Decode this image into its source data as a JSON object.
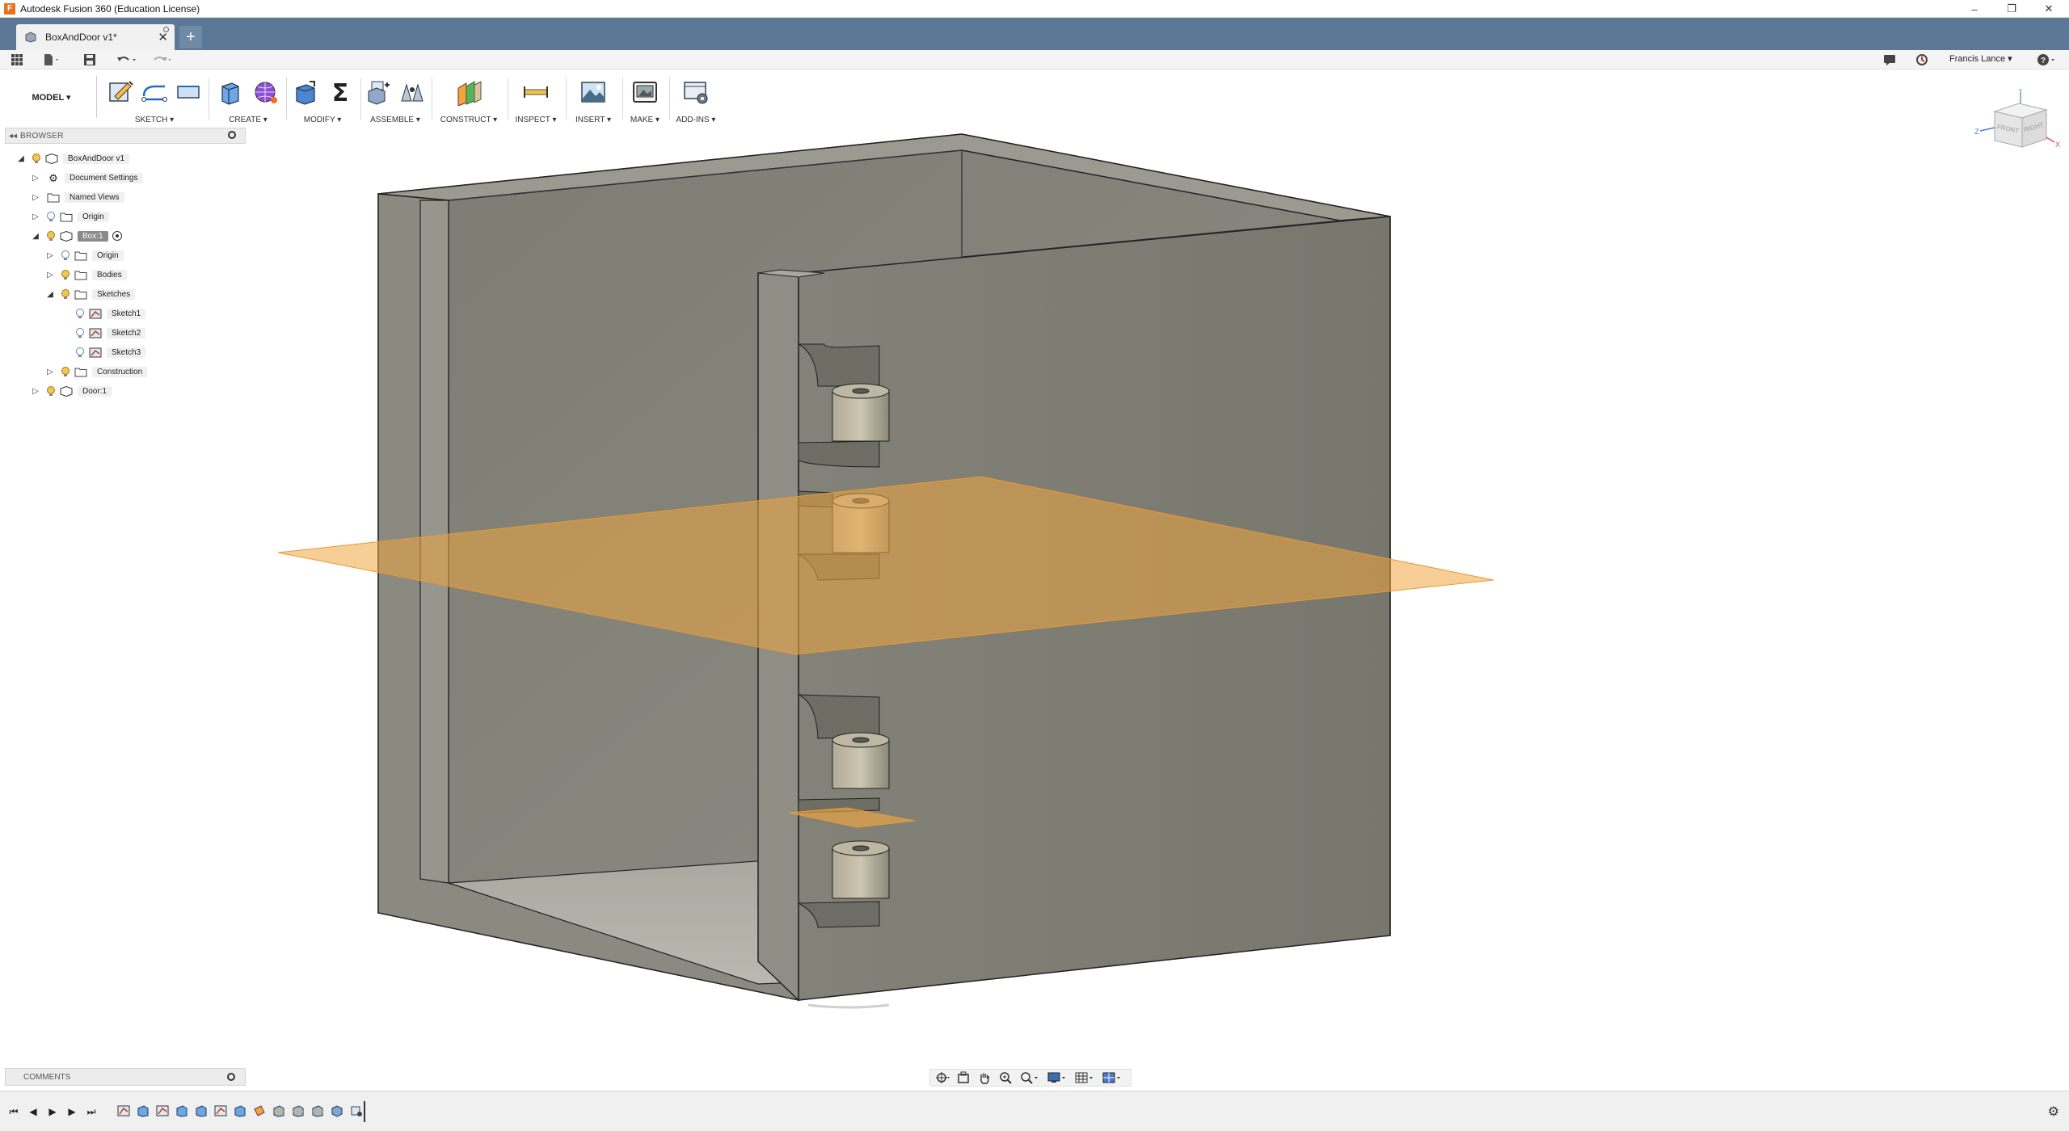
{
  "window": {
    "title": "Autodesk Fusion 360 (Education License)",
    "controls": {
      "minimize": "–",
      "restore": "❐",
      "close": "✕"
    }
  },
  "tabs": {
    "active": {
      "label": "BoxAndDoor v1*",
      "close": "✕"
    },
    "new_tab": "+"
  },
  "qat": {
    "user": "Francis Lance ▾",
    "help": "?"
  },
  "ribbon": {
    "workspace": "MODEL ▾",
    "groups": {
      "sketch": "SKETCH ▾",
      "create": "CREATE ▾",
      "modify": "MODIFY ▾",
      "assemble": "ASSEMBLE ▾",
      "construct": "CONSTRUCT ▾",
      "inspect": "INSPECT ▾",
      "insert": "INSERT ▾",
      "make": "MAKE ▾",
      "addins": "ADD-INS ▾"
    }
  },
  "browser": {
    "header": "BROWSER",
    "collapse": "◂◂",
    "tree": {
      "root": "BoxAndDoor v1",
      "document_settings": "Document Settings",
      "named_views": "Named Views",
      "origin": "Origin",
      "box": "Box:1",
      "box_origin": "Origin",
      "bodies": "Bodies",
      "sketches": "Sketches",
      "sketch1": "Sketch1",
      "sketch2": "Sketch2",
      "sketch3": "Sketch3",
      "construction": "Construction",
      "door": "Door:1"
    }
  },
  "viewcube": {
    "front": "FRONT",
    "right": "RIGHT",
    "axis_x": "X",
    "axis_y": "Y",
    "axis_z": "Z"
  },
  "comments": {
    "header": "COMMENTS"
  },
  "colors": {
    "accent_tab": "#5b7897",
    "model_face": "#8a8a80",
    "plane": "#f0a640"
  }
}
